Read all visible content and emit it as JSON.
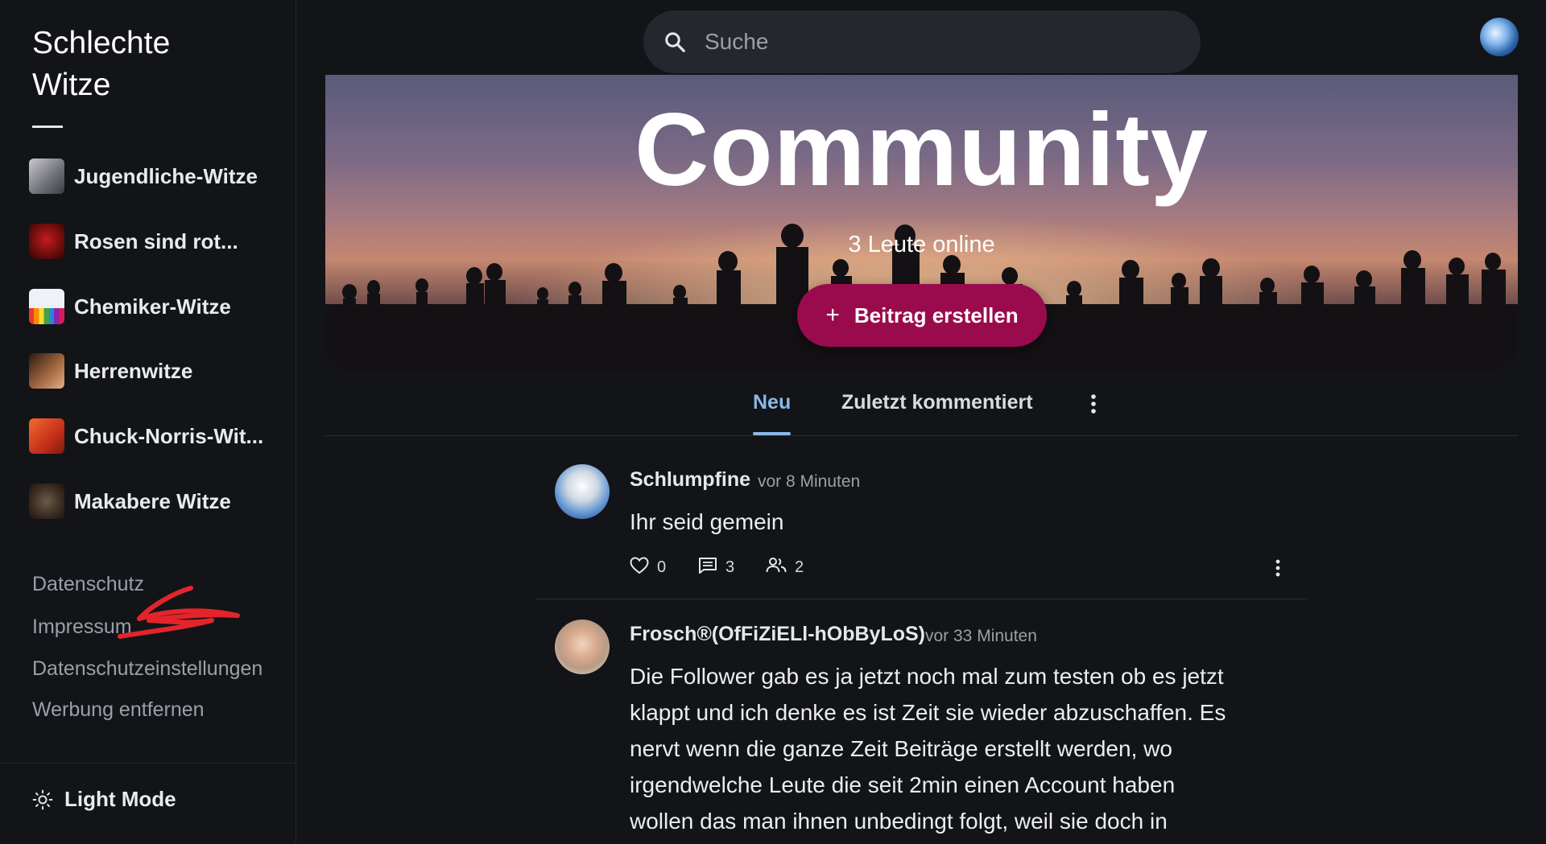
{
  "brand": {
    "line1": "Schlechte",
    "line2": "Witze"
  },
  "sidebar": {
    "communities": [
      {
        "label": "Jugendliche-Witze",
        "thumb_color": "#8d8f96"
      },
      {
        "label": "Rosen sind rot...",
        "thumb_color": "#8b1a1a"
      },
      {
        "label": "Chemiker-Witze",
        "thumb_color": "#dfe7ef"
      },
      {
        "label": "Herrenwitze",
        "thumb_color": "#8a5a3f"
      },
      {
        "label": "Chuck-Norris-Wit...",
        "thumb_color": "#d8451f"
      },
      {
        "label": "Makabere Witze",
        "thumb_color": "#4a3a30"
      }
    ],
    "footer_links": [
      "Datenschutz",
      "Impressum",
      "Datenschutzeinstellungen",
      "Werbung entfernen"
    ],
    "light_mode_label": "Light Mode",
    "light_mode_icon": "sun-icon"
  },
  "search": {
    "placeholder": "Suche",
    "icon": "search-icon"
  },
  "banner": {
    "title": "Community",
    "online": "3 Leute online",
    "create_button": "Beitrag erstellen",
    "create_button_color": "#9a0b4d"
  },
  "tabs": [
    {
      "label": "Neu",
      "active": true
    },
    {
      "label": "Zuletzt kommentiert",
      "active": false
    }
  ],
  "accent_color": "#8ab8e8",
  "posts": [
    {
      "author": "Schlumpfine",
      "time": "vor 8 Minuten",
      "text": "Ihr seid gemein",
      "likes": "0",
      "comments": "3",
      "followers": "2"
    },
    {
      "author": "Frosch®(OfFiZiELl-hObByLoS)",
      "time": "vor 33 Minuten",
      "lines": [
        "Die Follower gab es ja jetzt noch mal zum testen ob es jetzt",
        "klappt und ich denke es ist Zeit sie wieder abzuschaffen. Es",
        "nervt wenn die ganze Zeit Beiträge erstellt werden, wo",
        "irgendwelche Leute die seit 2min einen Account haben",
        "wollen das man ihnen unbedingt folgt, weil sie doch in"
      ]
    }
  ]
}
